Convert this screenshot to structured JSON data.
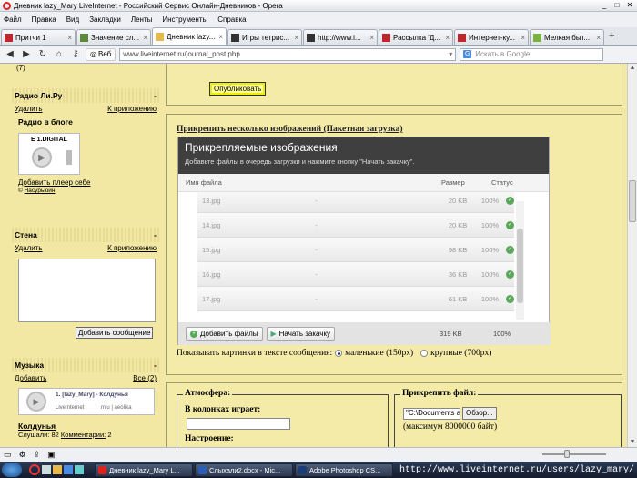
{
  "window": {
    "title": "Дневник lazy_Mary LiveInternet - Российский Сервис Онлайн-Дневников - Opera"
  },
  "menu": [
    "Файл",
    "Правка",
    "Вид",
    "Закладки",
    "Ленты",
    "Инструменты",
    "Справка"
  ],
  "tabs": [
    {
      "label": "Притчи 1",
      "color": "#c0272d"
    },
    {
      "label": "Значение сл...",
      "color": "#5a8a3a"
    },
    {
      "label": "Дневник lazy...",
      "color": "#e8b84a",
      "active": true
    },
    {
      "label": "Игры тетрис...",
      "color": "#333333"
    },
    {
      "label": "http://www.i...",
      "color": "#333333"
    },
    {
      "label": "Рассылка 'Д...",
      "color": "#c0272d"
    },
    {
      "label": "Интернет-ку...",
      "color": "#c0272d"
    },
    {
      "label": "Мелкая быт...",
      "color": "#7ab23f"
    }
  ],
  "nav": {
    "web_label": "Веб",
    "address": "www.liveinternet.ru/journal_post.php",
    "search_placeholder": "Искать в Google",
    "search_engine": "G"
  },
  "sidebar": {
    "top_fragment": "(7)",
    "radio": {
      "title": "Радио Ли.Ру",
      "delete": "Удалить",
      "to_app": "К приложению",
      "blog_radio": "Радио в блоге",
      "player_brand": "E 1.DIGITAL",
      "add_player": "Добавить плеер себе",
      "credit_prefix": "©",
      "credit": "Насурьюин"
    },
    "wall": {
      "title": "Стена",
      "delete": "Удалить",
      "to_app": "К приложению",
      "add_message": "Добавить сообщение"
    },
    "music": {
      "title": "Музыка",
      "add": "Добавить",
      "all": "Все (2)",
      "track": "1. [lazy_Mary] - Колдунья",
      "player_source": "LiveInternet",
      "player_tags": "mju | aeolika",
      "song": "Колдунья",
      "listens_label": "Слушали:",
      "listens": "82",
      "comments_label": "Комментарии:",
      "comments": "2"
    }
  },
  "main": {
    "publish": "Опубликовать",
    "uploader_link": "Прикрепить несколько изображений (Пакетная загрузка)",
    "uploader": {
      "title": "Прикрепляемые изображения",
      "subtitle": "Добавьте файлы в очередь загрузки и нажмите кнопку \"Начать закачку\".",
      "col_name": "Имя файла",
      "col_size": "Размер",
      "col_status": "Статус",
      "files": [
        {
          "name": "13.jpg",
          "type": "-",
          "size": "20 KB",
          "pct": "100%"
        },
        {
          "name": "14.jpg",
          "type": "-",
          "size": "20 KB",
          "pct": "100%"
        },
        {
          "name": "15.jpg",
          "type": "-",
          "size": "98 KB",
          "pct": "100%"
        },
        {
          "name": "16.jpg",
          "type": "-",
          "size": "36 KB",
          "pct": "100%"
        },
        {
          "name": "17.jpg",
          "type": "-",
          "size": "61 KB",
          "pct": "100%"
        }
      ],
      "add_files": "Добавить файлы",
      "start_upload": "Начать закачку",
      "total_size": "319 KB",
      "total_pct": "100%"
    },
    "show_pics": {
      "label": "Показывать картинки в тексте сообщения:",
      "small": "маленькие (150px)",
      "large": "крупные (700px)",
      "selected": "small"
    },
    "atmosphere": {
      "legend": "Атмосфера:",
      "speakers_label": "В колонках играет:",
      "mood_label": "Настроение:"
    },
    "attach_file": {
      "legend": "Прикрепить файл:",
      "path": "\"C:\\Documents and S",
      "browse": "Обзор...",
      "max_note": "(максимум 8000000 байт)"
    }
  },
  "taskbar": [
    {
      "label": "Дневник lazy_Mary L...",
      "color": "#d22"
    },
    {
      "label": "Слыхали2.docx - Mic...",
      "color": "#2b5fb5"
    },
    {
      "label": "Adobe Photoshop CS...",
      "color": "#1c3d78"
    }
  ],
  "watermark": "http://www.liveinternet.ru/users/lazy_mary/"
}
